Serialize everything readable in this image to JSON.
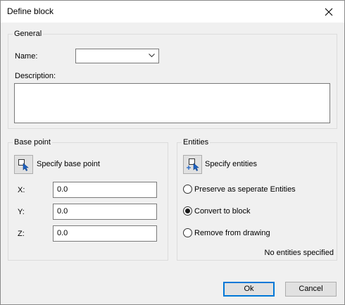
{
  "window": {
    "title": "Define block"
  },
  "general": {
    "group_label": "General",
    "name_label": "Name:",
    "name_value": "",
    "description_label": "Description:",
    "description_value": ""
  },
  "base_point": {
    "group_label": "Base point",
    "specify_label": "Specify base point",
    "x_label": "X:",
    "x_value": "0.0",
    "y_label": "Y:",
    "y_value": "0.0",
    "z_label": "Z:",
    "z_value": "0.0"
  },
  "entities": {
    "group_label": "Entities",
    "specify_label": "Specify entities",
    "options": [
      {
        "label": "Preserve as seperate Entities",
        "selected": false
      },
      {
        "label": "Convert to block",
        "selected": true
      },
      {
        "label": "Remove from drawing",
        "selected": false
      }
    ],
    "status": "No entities specified"
  },
  "buttons": {
    "ok": "Ok",
    "cancel": "Cancel"
  },
  "colors": {
    "accent": "#0078d7",
    "dialog_bg": "#f0f0f0"
  }
}
